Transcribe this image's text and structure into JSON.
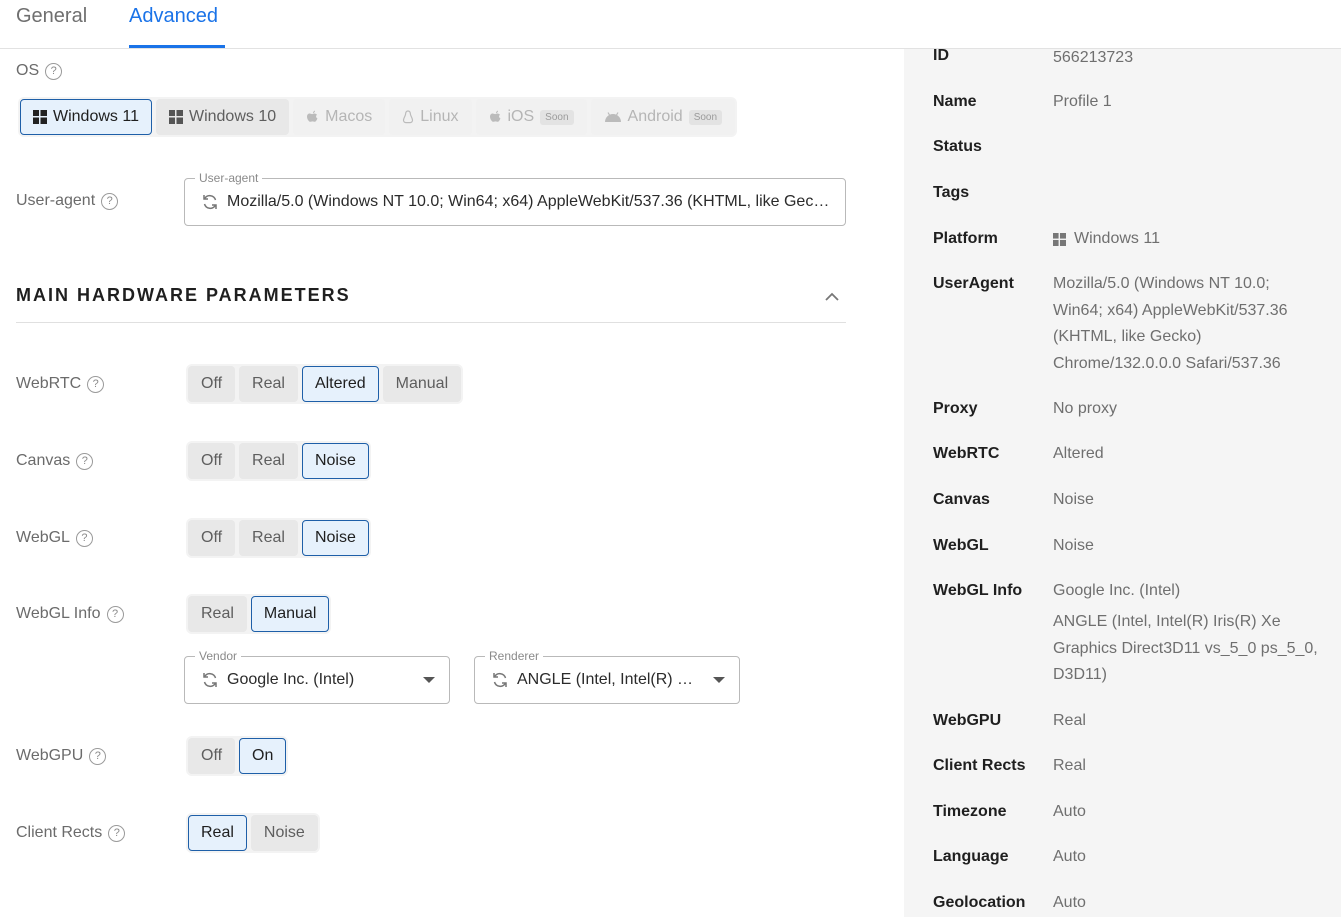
{
  "tabs": {
    "general": "General",
    "advanced": "Advanced"
  },
  "os": {
    "label": "OS",
    "help": "?",
    "options": [
      {
        "label": "Windows 11",
        "icon": "windows-icon",
        "selected": true
      },
      {
        "label": "Windows 10",
        "icon": "windows-icon",
        "selected": false
      },
      {
        "label": "Macos",
        "icon": "apple-icon",
        "disabled": true
      },
      {
        "label": "Linux",
        "icon": "linux-icon",
        "disabled": true
      },
      {
        "label": "iOS",
        "icon": "apple-icon",
        "disabled": true,
        "badge": "Soon"
      },
      {
        "label": "Android",
        "icon": "android-icon",
        "disabled": true,
        "badge": "Soon"
      }
    ]
  },
  "useragent": {
    "label": "User-agent",
    "legend": "User-agent",
    "value": "Mozilla/5.0 (Windows NT 10.0; Win64; x64) AppleWebKit/537.36 (KHTML, like Gecko) Chrome/132.0.0.0 Safari/537.36"
  },
  "section": {
    "title": "MAIN HARDWARE PARAMETERS"
  },
  "webrtc": {
    "label": "WebRTC",
    "options": [
      "Off",
      "Real",
      "Altered",
      "Manual"
    ],
    "selected": "Altered"
  },
  "canvas": {
    "label": "Canvas",
    "options": [
      "Off",
      "Real",
      "Noise"
    ],
    "selected": "Noise"
  },
  "webgl": {
    "label": "WebGL",
    "options": [
      "Off",
      "Real",
      "Noise"
    ],
    "selected": "Noise"
  },
  "webglinfo": {
    "label": "WebGL Info",
    "options": [
      "Real",
      "Manual"
    ],
    "selected": "Manual",
    "vendor_legend": "Vendor",
    "vendor_value": "Google Inc. (Intel)",
    "renderer_legend": "Renderer",
    "renderer_value": "ANGLE (Intel, Intel(R) Iris(R) Xe Graphics Direct3D11 vs_5_0 ps_5_0, D3D11)"
  },
  "webgpu": {
    "label": "WebGPU",
    "options": [
      "Off",
      "On"
    ],
    "selected": "On"
  },
  "clientrects": {
    "label": "Client Rects",
    "options": [
      "Real",
      "Noise"
    ],
    "selected": "Real"
  },
  "summary": {
    "id_key": "ID",
    "id_val": "566213723",
    "name_key": "Name",
    "name_val": "Profile 1",
    "status_key": "Status",
    "tags_key": "Tags",
    "platform_key": "Platform",
    "platform_val": "Windows 11",
    "ua_key": "UserAgent",
    "ua_val": "Mozilla/5.0 (Windows NT 10.0; Win64; x64) AppleWebKit/537.36 (KHTML, like Gecko) Chrome/132.0.0.0 Safari/537.36",
    "proxy_key": "Proxy",
    "proxy_val": "No proxy",
    "webrtc_key": "WebRTC",
    "webrtc_val": "Altered",
    "canvas_key": "Canvas",
    "canvas_val": "Noise",
    "webgl_key": "WebGL",
    "webgl_val": "Noise",
    "webglinfo_key": "WebGL Info",
    "webglinfo_vendor": "Google Inc. (Intel)",
    "webglinfo_renderer": "ANGLE (Intel, Intel(R) Iris(R) Xe Graphics Direct3D11 vs_5_0 ps_5_0, D3D11)",
    "webgpu_key": "WebGPU",
    "webgpu_val": "Real",
    "clientrects_key": "Client Rects",
    "clientrects_val": "Real",
    "timezone_key": "Timezone",
    "timezone_val": "Auto",
    "language_key": "Language",
    "language_val": "Auto",
    "geolocation_key": "Geolocation",
    "geolocation_val": "Auto"
  }
}
